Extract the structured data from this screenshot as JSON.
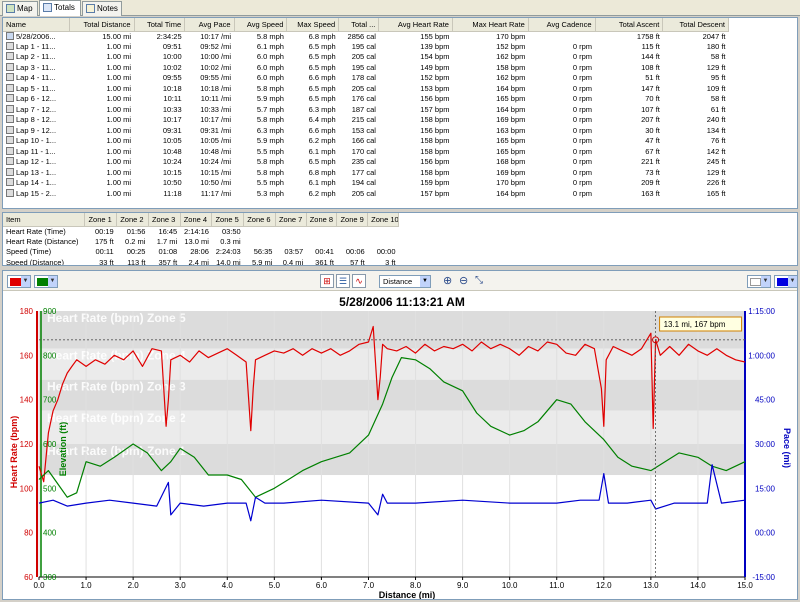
{
  "tabs": [
    {
      "label": "Map",
      "active": false
    },
    {
      "label": "Totals",
      "active": true
    },
    {
      "label": "Notes",
      "active": false
    }
  ],
  "totals_table": {
    "columns": [
      "Name",
      "Total Distance",
      "Total Time",
      "Avg Pace",
      "Avg Speed",
      "Max Speed",
      "Total ...",
      "Avg Heart Rate",
      "Max Heart Rate",
      "Avg Cadence",
      "Total Ascent",
      "Total Descent"
    ],
    "rows": [
      [
        "5/28/2006...",
        "15.00 mi",
        "2:34:25",
        "10:17 /mi",
        "5.8 mph",
        "6.8 mph",
        "2856 cal",
        "155 bpm",
        "170 bpm",
        "",
        "1758 ft",
        "2047 ft"
      ],
      [
        "Lap 1 - 11...",
        "1.00 mi",
        "09:51",
        "09:52 /mi",
        "6.1 mph",
        "6.5 mph",
        "195 cal",
        "139 bpm",
        "152 bpm",
        "0 rpm",
        "115 ft",
        "180 ft"
      ],
      [
        "Lap 2 - 11...",
        "1.00 mi",
        "10:00",
        "10:00 /mi",
        "6.0 mph",
        "6.5 mph",
        "205 cal",
        "154 bpm",
        "162 bpm",
        "0 rpm",
        "144 ft",
        "58 ft"
      ],
      [
        "Lap 3 - 11...",
        "1.00 mi",
        "10:02",
        "10:02 /mi",
        "6.0 mph",
        "6.5 mph",
        "195 cal",
        "149 bpm",
        "158 bpm",
        "0 rpm",
        "108 ft",
        "129 ft"
      ],
      [
        "Lap 4 - 11...",
        "1.00 mi",
        "09:55",
        "09:55 /mi",
        "6.0 mph",
        "6.6 mph",
        "178 cal",
        "152 bpm",
        "162 bpm",
        "0 rpm",
        "51 ft",
        "95 ft"
      ],
      [
        "Lap 5 - 11...",
        "1.00 mi",
        "10:18",
        "10:18 /mi",
        "5.8 mph",
        "6.5 mph",
        "205 cal",
        "153 bpm",
        "164 bpm",
        "0 rpm",
        "147 ft",
        "109 ft"
      ],
      [
        "Lap 6 - 12...",
        "1.00 mi",
        "10:11",
        "10:11 /mi",
        "5.9 mph",
        "6.5 mph",
        "176 cal",
        "156 bpm",
        "165 bpm",
        "0 rpm",
        "70 ft",
        "58 ft"
      ],
      [
        "Lap 7 - 12...",
        "1.00 mi",
        "10:33",
        "10:33 /mi",
        "5.7 mph",
        "6.3 mph",
        "187 cal",
        "157 bpm",
        "164 bpm",
        "0 rpm",
        "107 ft",
        "61 ft"
      ],
      [
        "Lap 8 - 12...",
        "1.00 mi",
        "10:17",
        "10:17 /mi",
        "5.8 mph",
        "6.4 mph",
        "215 cal",
        "158 bpm",
        "169 bpm",
        "0 rpm",
        "207 ft",
        "240 ft"
      ],
      [
        "Lap 9 - 12...",
        "1.00 mi",
        "09:31",
        "09:31 /mi",
        "6.3 mph",
        "6.6 mph",
        "153 cal",
        "156 bpm",
        "163 bpm",
        "0 rpm",
        "30 ft",
        "134 ft"
      ],
      [
        "Lap 10 - 1...",
        "1.00 mi",
        "10:05",
        "10:05 /mi",
        "5.9 mph",
        "6.2 mph",
        "166 cal",
        "158 bpm",
        "165 bpm",
        "0 rpm",
        "47 ft",
        "76 ft"
      ],
      [
        "Lap 11 - 1...",
        "1.00 mi",
        "10:48",
        "10:48 /mi",
        "5.5 mph",
        "6.1 mph",
        "170 cal",
        "158 bpm",
        "165 bpm",
        "0 rpm",
        "67 ft",
        "142 ft"
      ],
      [
        "Lap 12 - 1...",
        "1.00 mi",
        "10:24",
        "10:24 /mi",
        "5.8 mph",
        "6.5 mph",
        "235 cal",
        "156 bpm",
        "168 bpm",
        "0 rpm",
        "221 ft",
        "245 ft"
      ],
      [
        "Lap 13 - 1...",
        "1.00 mi",
        "10:15",
        "10:15 /mi",
        "5.8 mph",
        "6.8 mph",
        "177 cal",
        "158 bpm",
        "169 bpm",
        "0 rpm",
        "73 ft",
        "129 ft"
      ],
      [
        "Lap 14 - 1...",
        "1.00 mi",
        "10:50",
        "10:50 /mi",
        "5.5 mph",
        "6.1 mph",
        "194 cal",
        "159 bpm",
        "170 bpm",
        "0 rpm",
        "209 ft",
        "226 ft"
      ],
      [
        "Lap 15 - 2...",
        "1.00 mi",
        "11:18",
        "11:17 /mi",
        "5.3 mph",
        "6.2 mph",
        "205 cal",
        "157 bpm",
        "164 bpm",
        "0 rpm",
        "163 ft",
        "165 ft"
      ]
    ]
  },
  "zones_table": {
    "columns": [
      "Item",
      "Zone 1",
      "Zone 2",
      "Zone 3",
      "Zone 4",
      "Zone 5",
      "Zone 6",
      "Zone 7",
      "Zone 8",
      "Zone 9",
      "Zone 10"
    ],
    "rows": [
      [
        "Heart Rate (Time)",
        "00:19",
        "01:56",
        "16:45",
        "2:14:16",
        "03:50",
        "",
        "",
        "",
        "",
        ""
      ],
      [
        "Heart Rate (Distance)",
        "175 ft",
        "0.2 mi",
        "1.7 mi",
        "13.0 mi",
        "0.3 mi",
        "",
        "",
        "",
        "",
        ""
      ],
      [
        "Speed (Time)",
        "00:11",
        "00:25",
        "01:08",
        "28:06",
        "2:24:03",
        "56:35",
        "03:57",
        "00:41",
        "00:06",
        "00:00"
      ],
      [
        "Speed (Distance)",
        "33 ft",
        "113 ft",
        "357 ft",
        "2.4 mi",
        "14.0 mi",
        "5.9 mi",
        "0.4 mi",
        "361 ft",
        "57 ft",
        "3 ft"
      ]
    ]
  },
  "toolbar": {
    "left_colors": [
      "#e00000",
      "#008000"
    ],
    "right_colors": [
      "#ffffff",
      "#0000e0"
    ],
    "x_axis_select": "Distance"
  },
  "chart_data": {
    "type": "line",
    "title": "5/28/2006 11:13:21 AM",
    "xlabel": "Distance (mi)",
    "xlim": [
      0,
      15
    ],
    "x_ticks": [
      "0.0",
      "1.0",
      "2.0",
      "3.0",
      "4.0",
      "5.0",
      "6.0",
      "7.0",
      "8.0",
      "9.0",
      "10.0",
      "11.0",
      "12.0",
      "13.0",
      "14.0",
      "15.0"
    ],
    "y_axes": [
      {
        "label": "Heart Rate (bpm)",
        "color": "#d00000",
        "range": [
          60,
          180
        ],
        "ticks": [
          "60",
          "80",
          "100",
          "120",
          "140",
          "160",
          "180"
        ]
      },
      {
        "label": "Elevation (ft)",
        "color": "#008000",
        "range": [
          300,
          900
        ],
        "ticks": [
          "300",
          "400",
          "500",
          "600",
          "700",
          "800",
          "900"
        ]
      },
      {
        "label": "Pace (mi)",
        "color": "#0000c0",
        "range": [
          -15,
          75
        ],
        "ticks": [
          "-15:00",
          "00:00",
          "15:00",
          "30:00",
          "45:00",
          "1:00:00",
          "1:15:00"
        ]
      }
    ],
    "zones": [
      {
        "label": "Heart Rate (bpm) Zone 5",
        "range": [
          163,
          180
        ]
      },
      {
        "label": "Heart Rate (bpm) Zone 4",
        "range": [
          149,
          163
        ]
      },
      {
        "label": "Heart Rate (bpm) Zone 3",
        "range": [
          135,
          149
        ]
      },
      {
        "label": "Heart Rate (bpm) Zone 2",
        "range": [
          120,
          135
        ]
      },
      {
        "label": "Heart Rate (bpm) Zone 1",
        "range": [
          106,
          120
        ]
      }
    ],
    "series": [
      {
        "name": "Heart Rate (bpm)",
        "color": "#e00000",
        "x": [
          0.0,
          0.1,
          0.2,
          0.3,
          0.4,
          0.5,
          0.6,
          0.7,
          0.8,
          1.0,
          1.2,
          1.4,
          1.6,
          1.8,
          2.0,
          2.2,
          2.4,
          2.6,
          2.7,
          2.75,
          2.8,
          3.0,
          3.2,
          3.4,
          3.6,
          3.8,
          4.0,
          4.2,
          4.4,
          4.5,
          4.55,
          4.6,
          4.8,
          5.0,
          5.2,
          5.4,
          5.6,
          5.8,
          6.0,
          6.2,
          6.4,
          6.6,
          6.8,
          7.0,
          7.1,
          7.2,
          7.25,
          7.3,
          7.4,
          7.6,
          7.8,
          8.0,
          8.2,
          8.4,
          8.6,
          8.8,
          9.0,
          9.2,
          9.4,
          9.6,
          9.8,
          10.0,
          10.2,
          10.4,
          10.6,
          10.8,
          11.0,
          11.2,
          11.4,
          11.6,
          11.8,
          11.95,
          12.0,
          12.05,
          12.2,
          12.4,
          12.6,
          12.8,
          13.0,
          13.05,
          13.1,
          13.2,
          13.4,
          13.6,
          13.8,
          14.0,
          14.2,
          14.4,
          14.6,
          14.8,
          15.0
        ],
        "y": [
          110,
          103,
          125,
          135,
          140,
          147,
          152,
          155,
          158,
          155,
          158,
          156,
          160,
          158,
          162,
          155,
          163,
          162,
          128,
          140,
          158,
          160,
          157,
          162,
          159,
          161,
          163,
          160,
          157,
          126,
          145,
          158,
          160,
          162,
          161,
          163,
          160,
          163,
          161,
          163,
          160,
          162,
          165,
          166,
          173,
          140,
          150,
          165,
          163,
          162,
          164,
          161,
          165,
          162,
          164,
          163,
          165,
          162,
          166,
          163,
          165,
          163,
          160,
          164,
          162,
          166,
          165,
          161,
          160,
          165,
          163,
          145,
          128,
          158,
          164,
          162,
          160,
          163,
          170,
          127,
          167,
          160,
          164,
          160,
          165,
          162,
          160,
          163,
          160,
          158,
          157
        ]
      },
      {
        "name": "Elevation (ft)",
        "color": "#008000",
        "x": [
          0.0,
          0.2,
          0.4,
          0.6,
          0.8,
          1.0,
          1.3,
          1.6,
          2.0,
          2.3,
          2.6,
          2.8,
          3.0,
          3.3,
          3.6,
          4.0,
          4.3,
          4.6,
          5.0,
          5.3,
          5.6,
          6.0,
          6.3,
          6.6,
          7.0,
          7.3,
          7.5,
          7.7,
          8.0,
          8.3,
          8.6,
          9.0,
          9.3,
          9.6,
          10.0,
          10.3,
          10.6,
          11.0,
          11.3,
          11.6,
          12.0,
          12.3,
          12.6,
          13.0,
          13.3,
          13.6,
          14.0,
          14.3,
          14.6,
          15.0
        ],
        "y": [
          520,
          540,
          510,
          480,
          490,
          560,
          550,
          570,
          600,
          580,
          540,
          560,
          590,
          570,
          530,
          530,
          520,
          480,
          500,
          520,
          540,
          560,
          570,
          580,
          620,
          690,
          750,
          795,
          790,
          770,
          740,
          720,
          670,
          640,
          620,
          630,
          650,
          700,
          690,
          650,
          610,
          570,
          550,
          540,
          560,
          580,
          570,
          550,
          540,
          560
        ]
      },
      {
        "name": "Pace (mi)",
        "color": "#0000d0",
        "x": [
          0.0,
          0.3,
          0.6,
          1.0,
          1.5,
          2.0,
          2.5,
          2.75,
          2.8,
          3.0,
          3.5,
          4.0,
          4.4,
          4.5,
          4.6,
          4.8,
          5.2,
          6.0,
          7.0,
          7.2,
          7.3,
          7.4,
          8.0,
          9.0,
          10.0,
          11.0,
          11.5,
          11.9,
          12.0,
          12.1,
          12.5,
          13.0,
          13.1,
          13.5,
          14.0,
          14.2,
          14.3,
          14.5,
          15.0
        ],
        "y": [
          10,
          11,
          9,
          10,
          11,
          10,
          9,
          17,
          6,
          10,
          9,
          10,
          10,
          4,
          12,
          10,
          10,
          11,
          10,
          6,
          13,
          10,
          10,
          11,
          10,
          10,
          11,
          11,
          20,
          10,
          10,
          11,
          8,
          10,
          10,
          10,
          23,
          10,
          11
        ]
      }
    ],
    "tooltip": "13.1 mi, 167 bpm",
    "marker_x": 13.1
  }
}
